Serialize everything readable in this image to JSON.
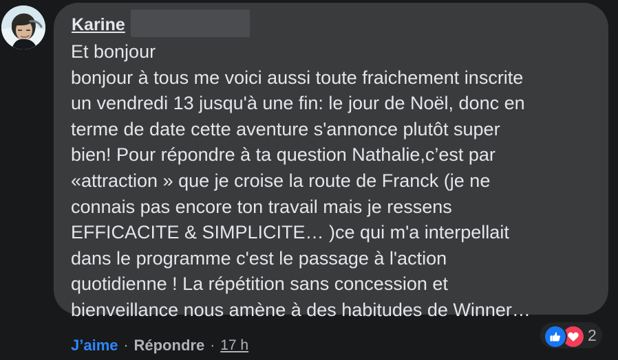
{
  "comment": {
    "author": "Karine",
    "lines": [
      "Et bonjour",
      "bonjour à tous me voici aussi toute fraichement inscrite",
      "un vendredi 13 jusqu'à une fin: le jour de Noël, donc en",
      "terme de date cette aventure s'annonce plutôt super",
      "bien! Pour répondre à ta question Nathalie,c’est par",
      "«attraction » que je croise la route de Franck (je ne",
      "connais pas encore ton travail mais je ressens",
      "EFFICACITE & SIMPLICITE… )ce qui m'a interpellait",
      "dans le programme c'est le passage à l'action",
      "quotidienne ! La répétition sans concession et",
      "bienveillance nous amène à des habitudes de Winner…"
    ],
    "reactions": {
      "count": "2",
      "icons": [
        "like-icon",
        "heart-icon"
      ],
      "like_color": "#1877f2",
      "love_color": "#f33e58"
    },
    "actions": {
      "like": "J’aime",
      "separator": "·",
      "reply": "Répondre",
      "timestamp": "17 h"
    }
  },
  "theme": {
    "page_background": "#18191a",
    "bubble_background": "#3a3b3c",
    "primary_text": "#e4e6eb",
    "secondary_text": "#b0b3b8",
    "accent": "#2d88ff"
  }
}
